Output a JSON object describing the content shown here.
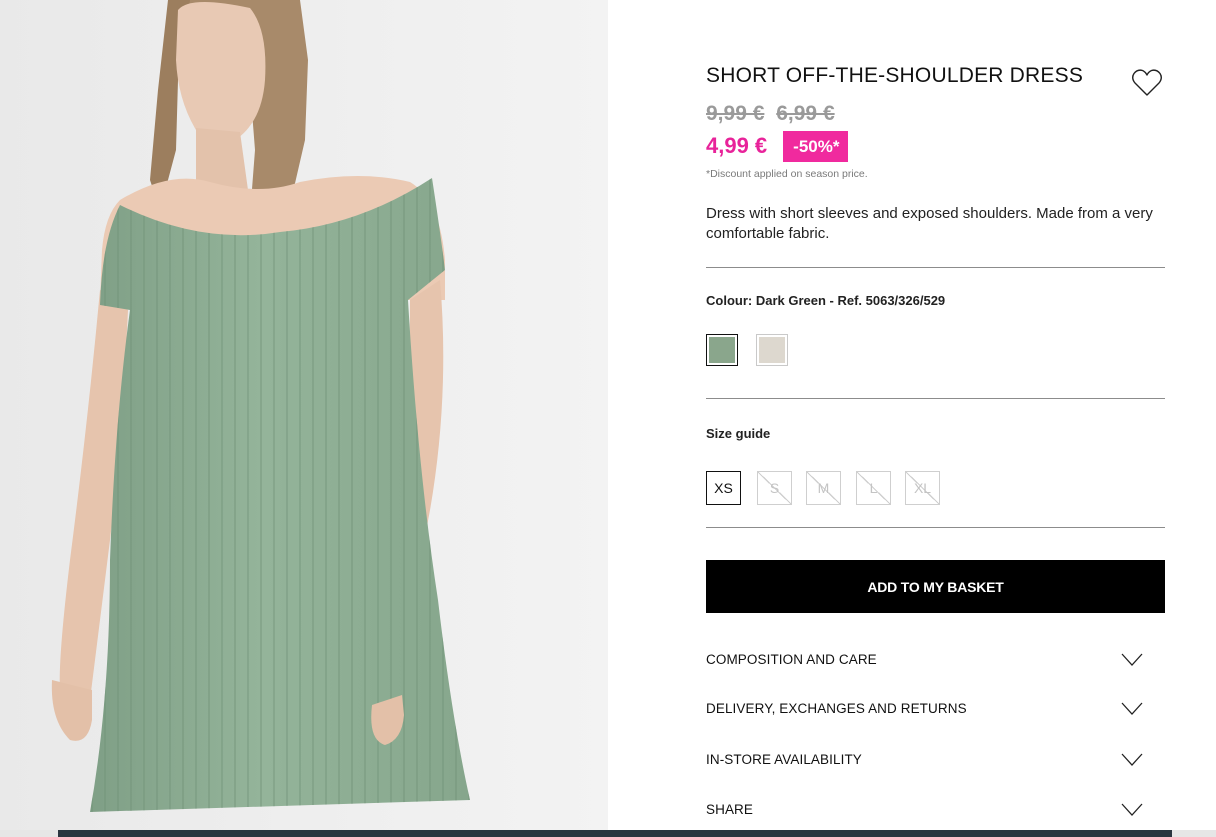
{
  "product": {
    "title": "SHORT OFF-THE-SHOULDER DRESS",
    "old_prices": [
      "9,99 €",
      "6,99 €"
    ],
    "current_price": "4,99 €",
    "discount_badge": "-50%*",
    "discount_note": "*Discount applied on season price.",
    "description": "Dress with short sleeves and exposed shoulders. Made from a very comfortable fabric."
  },
  "colour": {
    "label": "Colour: Dark Green - Ref. 5063/326/529",
    "swatches": [
      {
        "name": "Dark Green",
        "color": "#8aa68c",
        "selected": true
      },
      {
        "name": "Beige",
        "color": "#ddd8cf",
        "selected": false
      }
    ]
  },
  "sizes": {
    "guide_label": "Size guide",
    "options": [
      {
        "label": "XS",
        "available": true
      },
      {
        "label": "S",
        "available": false
      },
      {
        "label": "M",
        "available": false
      },
      {
        "label": "L",
        "available": false
      },
      {
        "label": "XL",
        "available": false
      }
    ]
  },
  "actions": {
    "add_to_basket": "ADD TO MY BASKET",
    "wishlist_icon": "heart-icon"
  },
  "accordions": [
    {
      "label": "COMPOSITION AND CARE"
    },
    {
      "label": "DELIVERY, EXCHANGES AND RETURNS"
    },
    {
      "label": "IN-STORE AVAILABILITY"
    },
    {
      "label": "SHARE"
    }
  ],
  "colors": {
    "price_accent": "#e8239a",
    "badge_bg": "#f02a9e",
    "button_bg": "#000000",
    "dress_green": "#8fb096"
  }
}
